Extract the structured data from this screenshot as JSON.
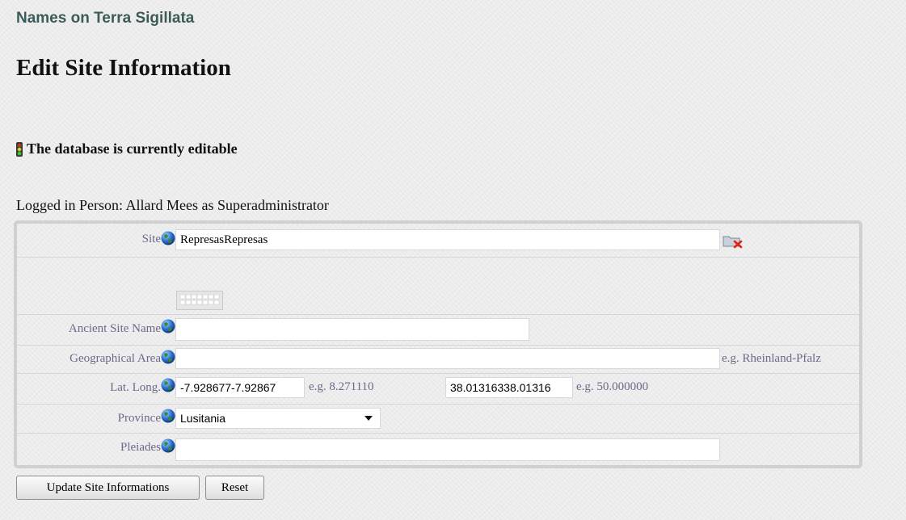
{
  "app_title": "Names on Terra Sigillata",
  "page_title": "Edit Site Information",
  "status_text": "The database is currently editable",
  "logged_in": "Logged in Person: Allard Mees as Superadministrator",
  "form": {
    "site": {
      "label": "Site",
      "value": "RepresasRepresas"
    },
    "ancient_site_name": {
      "label": "Ancient Site Name",
      "value": ""
    },
    "geographical_area": {
      "label": "Geographical Area",
      "value": "",
      "hint": "e.g. Rheinland-Pfalz"
    },
    "lat_long": {
      "label": "Lat. Long.",
      "long_value": "-7.928677-7.92867",
      "long_hint": "e.g. 8.271110",
      "lat_value": "38.01316338.01316",
      "lat_hint": "e.g. 50.000000"
    },
    "province": {
      "label": "Province",
      "value": "Lusitania"
    },
    "pleiades": {
      "label": "Pleiades",
      "value": ""
    }
  },
  "buttons": {
    "update": "Update Site Informations",
    "reset": "Reset"
  },
  "icons": {
    "globe": "globe-icon",
    "traffic_light": "traffic-light-icon",
    "folder_delete": "folder-delete-icon",
    "keyboard": "keyboard-icon",
    "dropdown": "chevron-down-icon"
  },
  "colors": {
    "app_title": "#3b5a5a",
    "label": "#6a6a8a"
  }
}
